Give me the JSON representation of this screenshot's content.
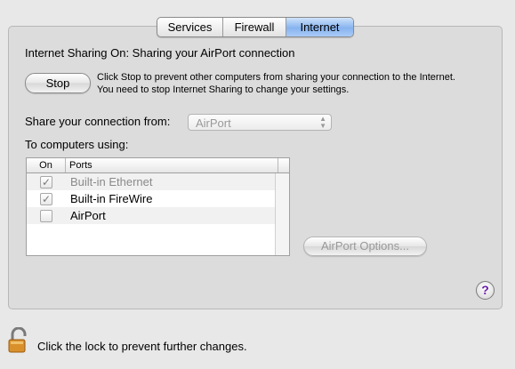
{
  "tabs": [
    {
      "label": "Services",
      "selected": false
    },
    {
      "label": "Firewall",
      "selected": false
    },
    {
      "label": "Internet",
      "selected": true
    }
  ],
  "status": "Internet Sharing On: Sharing your AirPort connection",
  "stop_button": "Stop",
  "stop_description": "Click Stop to prevent other computers from sharing your connection to the Internet. You need to stop Internet Sharing to change your settings.",
  "share_from_label": "Share your connection from:",
  "share_from_value": "AirPort",
  "to_computers_label": "To computers using:",
  "table": {
    "headers": {
      "on": "On",
      "ports": "Ports"
    },
    "rows": [
      {
        "port": "Built-in Ethernet",
        "checked": true
      },
      {
        "port": "Built-in FireWire",
        "checked": true
      },
      {
        "port": "AirPort",
        "checked": false
      }
    ]
  },
  "airport_options_button": "AirPort Options...",
  "help_button": "?",
  "lock_text": "Click the lock to prevent further changes.",
  "colors": {
    "selected_tab": "#86b3ef",
    "help": "#6a1fa8"
  }
}
